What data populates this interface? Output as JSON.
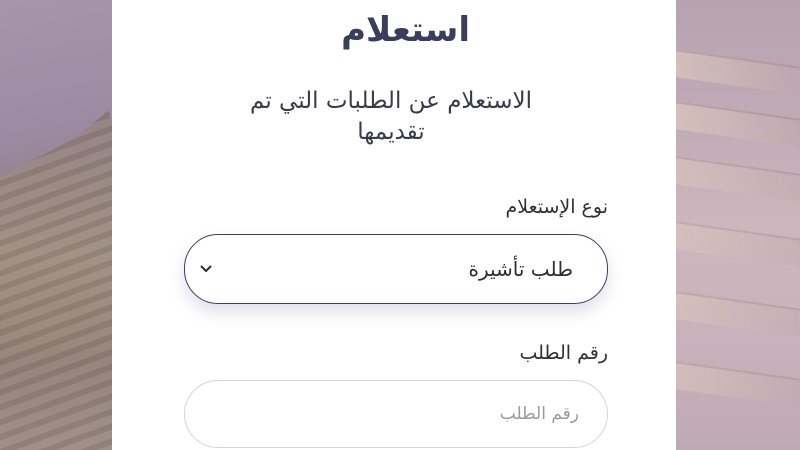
{
  "page": {
    "title": "استعلام",
    "subtitle": "الاستعلام عن الطلبات التي تم تقديمها"
  },
  "form": {
    "inquiry_type": {
      "label": "نوع الإستعلام",
      "selected": "طلب تأشيرة",
      "icon": "chevron-down-icon"
    },
    "request_number": {
      "label": "رقم الطلب",
      "placeholder": "رقم الطلب",
      "value": ""
    }
  },
  "colors": {
    "title": "#3a3d5c",
    "select_border": "#3d3f5e",
    "input_border": "#d4d4dc",
    "card_background": "#ffffff"
  }
}
